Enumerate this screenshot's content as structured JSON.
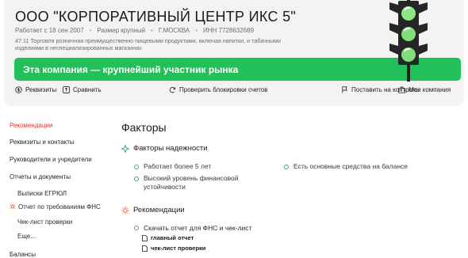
{
  "company": {
    "name": "ООО \"КОРПОРАТИВНЫЙ ЦЕНТР ИКС 5\"",
    "registered": "Работает с 18 сен 2007",
    "size": "Размер крупный",
    "city": "Г.МОСКВА",
    "inn": "ИНН 7728632689",
    "okved_line1": "47.11 Торговля розничная преимущественно пищевыми продуктами, включая напитки, и табачными",
    "okved_line2": "изделиями в неспециализированных магазинах",
    "banner": "Эта компания — крупнейший участник рынка"
  },
  "actions": {
    "requisites": "Реквизиты",
    "compare": "Сравнить",
    "check_blocks": "Проверить блокировки счетов",
    "monitor": "Поставить на контроль",
    "my_company": "Моя компания"
  },
  "sidebar": {
    "recommendations": "Рекомендации",
    "requisites_contacts": "Реквизиты и контакты",
    "management": "Руководители и учредители",
    "reports": "Отчеты и документы",
    "egrul": "Выписки ЕГРЮЛ",
    "fns_report": "Отчет по требованиям ФНС",
    "checklist": "Чек-лист проверки",
    "more": "Еще...",
    "balances": "Балансы"
  },
  "main": {
    "title": "Факторы",
    "reliability_heading": "Факторы надежности",
    "factor1": "Работает более 5 лет",
    "factor2_line1": "Высокий уровень финансовой",
    "factor2_line2": "устойчивости",
    "factor3": "Есть основные средства на балансе",
    "recommendations_heading": "Рекомендации",
    "rec1": "Скачать отчет для ФНС и чек-лист",
    "doc1": "главный отчет",
    "doc2": "чек-лист проверки"
  },
  "colors": {
    "accent_green": "#22c05a",
    "light_green": "#7fe07a",
    "active_red": "#d7372b",
    "card_bg": "#f3f3f1"
  }
}
